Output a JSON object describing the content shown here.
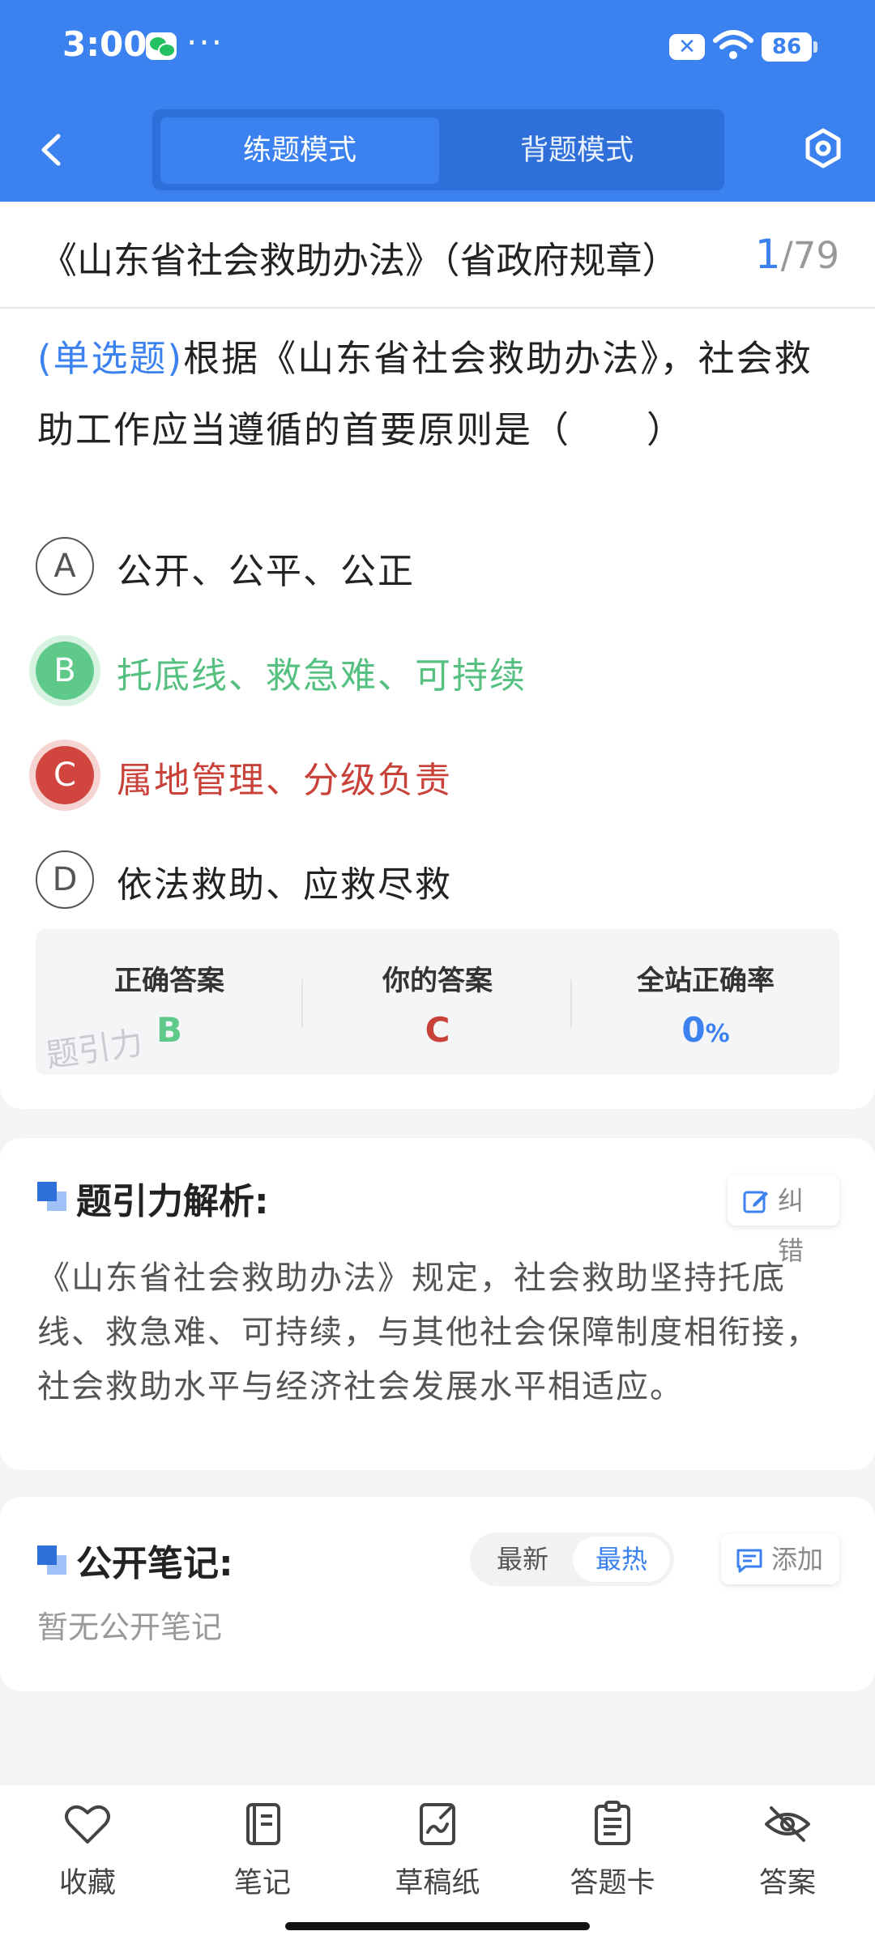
{
  "status_bar": {
    "time": "3:00",
    "dots": "···",
    "x_badge": "✕",
    "battery": "86"
  },
  "header": {
    "modes": [
      {
        "label": "练题模式",
        "active": true
      },
      {
        "label": "背题模式",
        "active": false
      }
    ],
    "accent_color": "#3b82f0"
  },
  "question": {
    "section_title": "《山东省社会救助办法》（省政府规章）",
    "current": "1",
    "total": "/79",
    "type_label": "(单选题)",
    "text": "根据《山东省社会救助办法》，社会救助工作应当遵循的首要原则是（　　）",
    "options": [
      {
        "key": "A",
        "text": "公开、公平、公正",
        "state": "normal"
      },
      {
        "key": "B",
        "text": "托底线、救急难、可持续",
        "state": "correct"
      },
      {
        "key": "C",
        "text": "属地管理、分级负责",
        "state": "wrong"
      },
      {
        "key": "D",
        "text": "依法救助、应救尽救",
        "state": "normal"
      }
    ]
  },
  "result": {
    "correct_label": "正确答案",
    "correct_value": "B",
    "yours_label": "你的答案",
    "yours_value": "C",
    "rate_label": "全站正确率",
    "rate_value": "0",
    "rate_unit": "%",
    "watermark": "题引力",
    "colors": {
      "correct": "#5fc98a",
      "wrong": "#d0463e",
      "rate": "#3b82f0"
    }
  },
  "analysis": {
    "title": "题引力解析:",
    "report_label": "纠错",
    "text": "《山东省社会救助办法》规定，社会救助坚持托底线、救急难、可持续，与其他社会保障制度相衔接，社会救助水平与经济社会发展水平相适应。"
  },
  "notes": {
    "title": "公开笔记:",
    "sort_options": [
      {
        "label": "最新",
        "active": false
      },
      {
        "label": "最热",
        "active": true
      }
    ],
    "add_label": "添加",
    "empty_text": "暂无公开笔记"
  },
  "toolbar": {
    "items": [
      {
        "label": "收藏",
        "icon": "heart-icon"
      },
      {
        "label": "笔记",
        "icon": "notebook-icon"
      },
      {
        "label": "草稿纸",
        "icon": "draft-icon"
      },
      {
        "label": "答题卡",
        "icon": "answer-card-icon"
      },
      {
        "label": "答案",
        "icon": "eye-off-icon"
      }
    ]
  }
}
